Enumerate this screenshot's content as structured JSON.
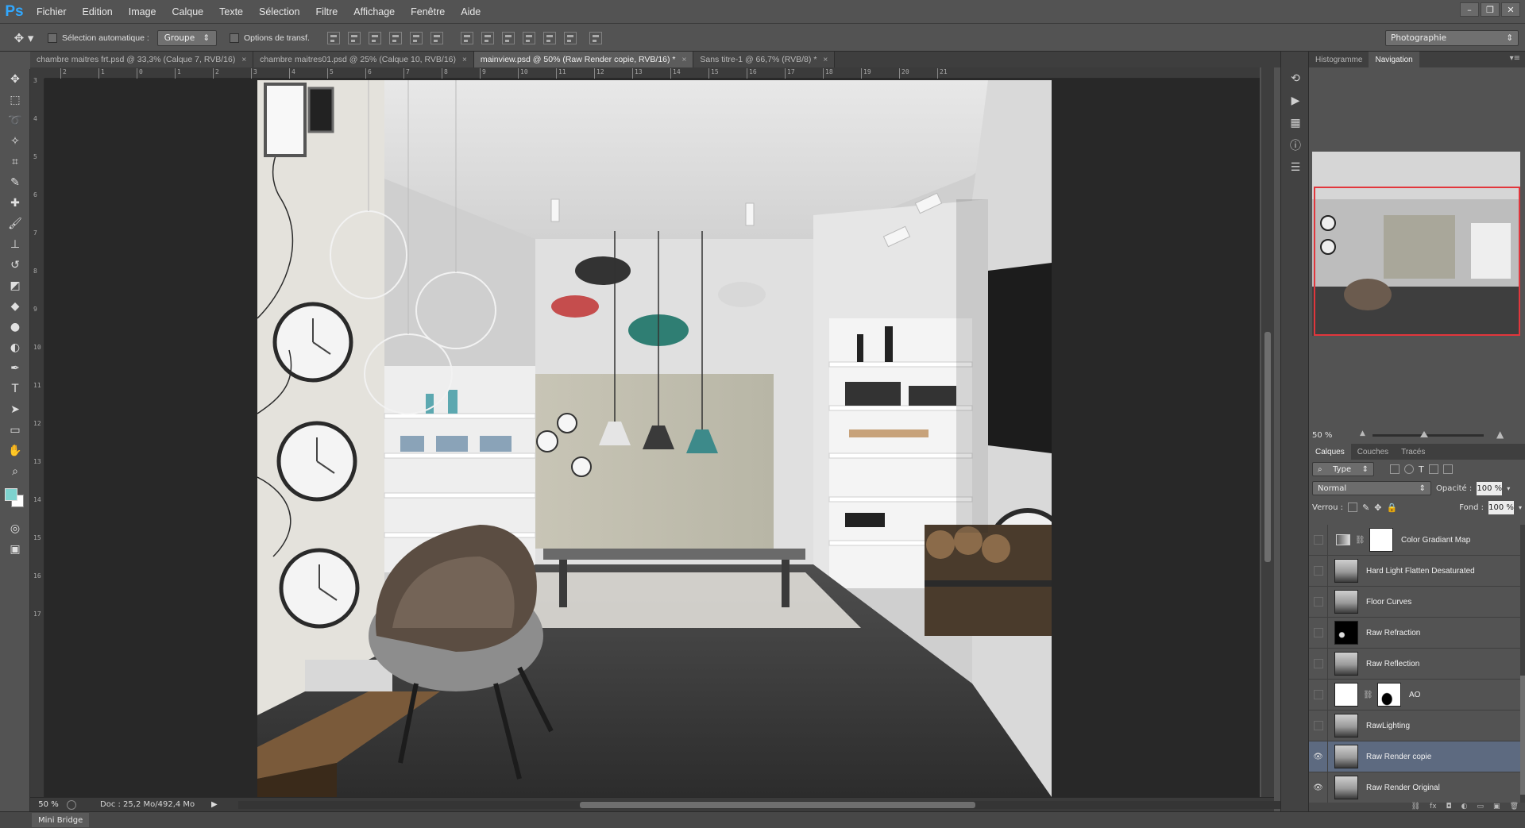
{
  "app": {
    "logo": "Ps",
    "menu": [
      "Fichier",
      "Edition",
      "Image",
      "Calque",
      "Texte",
      "Sélection",
      "Filtre",
      "Affichage",
      "Fenêtre",
      "Aide"
    ],
    "window_controls": [
      "–",
      "❐",
      "✕"
    ]
  },
  "options_bar": {
    "auto_select_label": "Sélection automatique :",
    "auto_select_mode": "Groupe",
    "transform_label": "Options de transf.",
    "workspace": "Photographie"
  },
  "doc_tabs": [
    {
      "label": "chambre maitres frt.psd @ 33,3% (Calque 7, RVB/16)",
      "active": false
    },
    {
      "label": "chambre maitres01.psd @ 25% (Calque 10, RVB/16)",
      "active": false
    },
    {
      "label": "mainview.psd @ 50% (Raw Render copie, RVB/16) *",
      "active": true
    },
    {
      "label": "Sans titre-1 @ 66,7% (RVB/8) *",
      "active": false
    }
  ],
  "ruler": {
    "h_ticks": [
      "2",
      "1",
      "0",
      "1",
      "2",
      "3",
      "4",
      "5",
      "6",
      "7",
      "8",
      "9",
      "10",
      "11",
      "12",
      "13",
      "14",
      "15",
      "16",
      "17",
      "18",
      "19",
      "20",
      "21"
    ],
    "v_ticks": [
      "3",
      "4",
      "5",
      "6",
      "7",
      "8",
      "9",
      "10",
      "11",
      "12",
      "13",
      "14",
      "15",
      "16",
      "17"
    ]
  },
  "status": {
    "zoom": "50 %",
    "doc_info": "Doc : 25,2 Mo/492,4 Mo"
  },
  "bottom": {
    "mini_bridge": "Mini Bridge"
  },
  "navigator_panel": {
    "tabs": [
      "Histogramme",
      "Navigation"
    ],
    "active_tab": "Navigation",
    "zoom": "50 %"
  },
  "layers_panel": {
    "tabs": [
      "Calques",
      "Couches",
      "Tracés"
    ],
    "filter_type": "Type",
    "blend_mode": "Normal",
    "opacity_label": "Opacité :",
    "opacity_value": "100 %",
    "lock_label": "Verrou :",
    "fill_label": "Fond :",
    "fill_value": "100 %",
    "layers": [
      {
        "name": "Color Gradiant Map",
        "visible": false,
        "selected": false,
        "kind": "adjustment"
      },
      {
        "name": "Hard Light Flatten Desaturated",
        "visible": false,
        "selected": false,
        "kind": "image"
      },
      {
        "name": "Floor Curves",
        "visible": false,
        "selected": false,
        "kind": "image"
      },
      {
        "name": "Raw Refraction",
        "visible": false,
        "selected": false,
        "kind": "dark"
      },
      {
        "name": "Raw Reflection",
        "visible": false,
        "selected": false,
        "kind": "image"
      },
      {
        "name": "AO",
        "visible": false,
        "selected": false,
        "kind": "mask"
      },
      {
        "name": "RawLighting",
        "visible": false,
        "selected": false,
        "kind": "image"
      },
      {
        "name": "Raw Render copie",
        "visible": true,
        "selected": true,
        "kind": "image"
      },
      {
        "name": "Raw Render Original",
        "visible": true,
        "selected": false,
        "kind": "image"
      }
    ]
  },
  "colors": {
    "foreground": "#7ed3cf",
    "background": "#ffffff",
    "nav_frame": "#e2363c",
    "selected_layer": "#5d6a80"
  }
}
